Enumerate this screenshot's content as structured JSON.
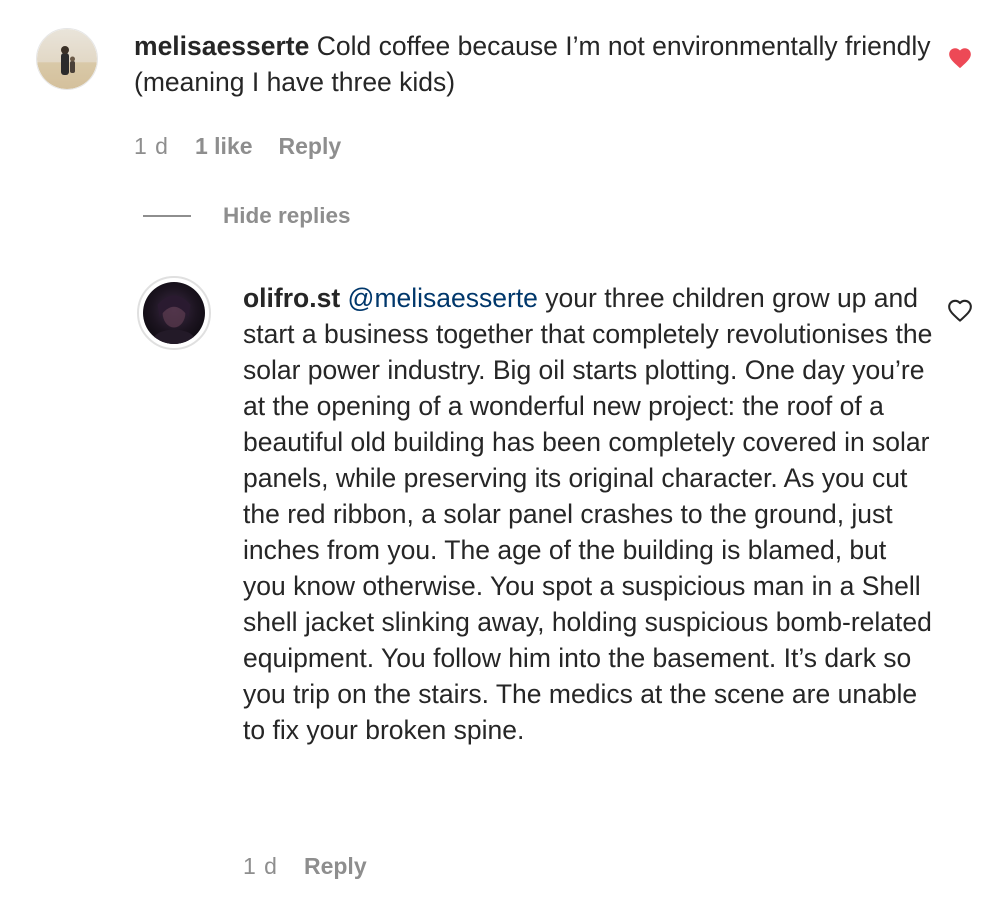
{
  "comment": {
    "username": "melisaesserte",
    "text": "Cold coffee because I’m not environmentally friendly (meaning I have three kids)",
    "time": "1 d",
    "likes": "1 like",
    "reply_label": "Reply",
    "liked": true,
    "avatar_icon": "profile-photo-beach"
  },
  "hide_replies_label": "Hide replies",
  "reply": {
    "username": "olifro.st",
    "mention": "@melisaesserte",
    "text": " your three children grow up and start a business together that completely revolutionises the solar power industry. Big oil starts plotting. One day you’re at the opening of a wonderful new project: the roof of a beautiful old building has been completely covered in solar panels, while preserving its original character. As you cut the red ribbon, a solar panel crashes to the ground, just inches from you. The age of the building is blamed, but you know otherwise. You spot a suspicious man in a Shell shell jacket slinking away, holding suspicious bomb-related equipment. You follow him into the basement. It’s dark so you trip on the stairs. The medics at the scene are unable to fix your broken spine.",
    "time": "1 d",
    "reply_label": "Reply",
    "liked": false,
    "avatar_icon": "profile-photo-dark"
  },
  "colors": {
    "heart_filled": "#ed4956",
    "heart_outline": "#262626",
    "mention": "#00376b",
    "meta": "#8e8e8e"
  }
}
